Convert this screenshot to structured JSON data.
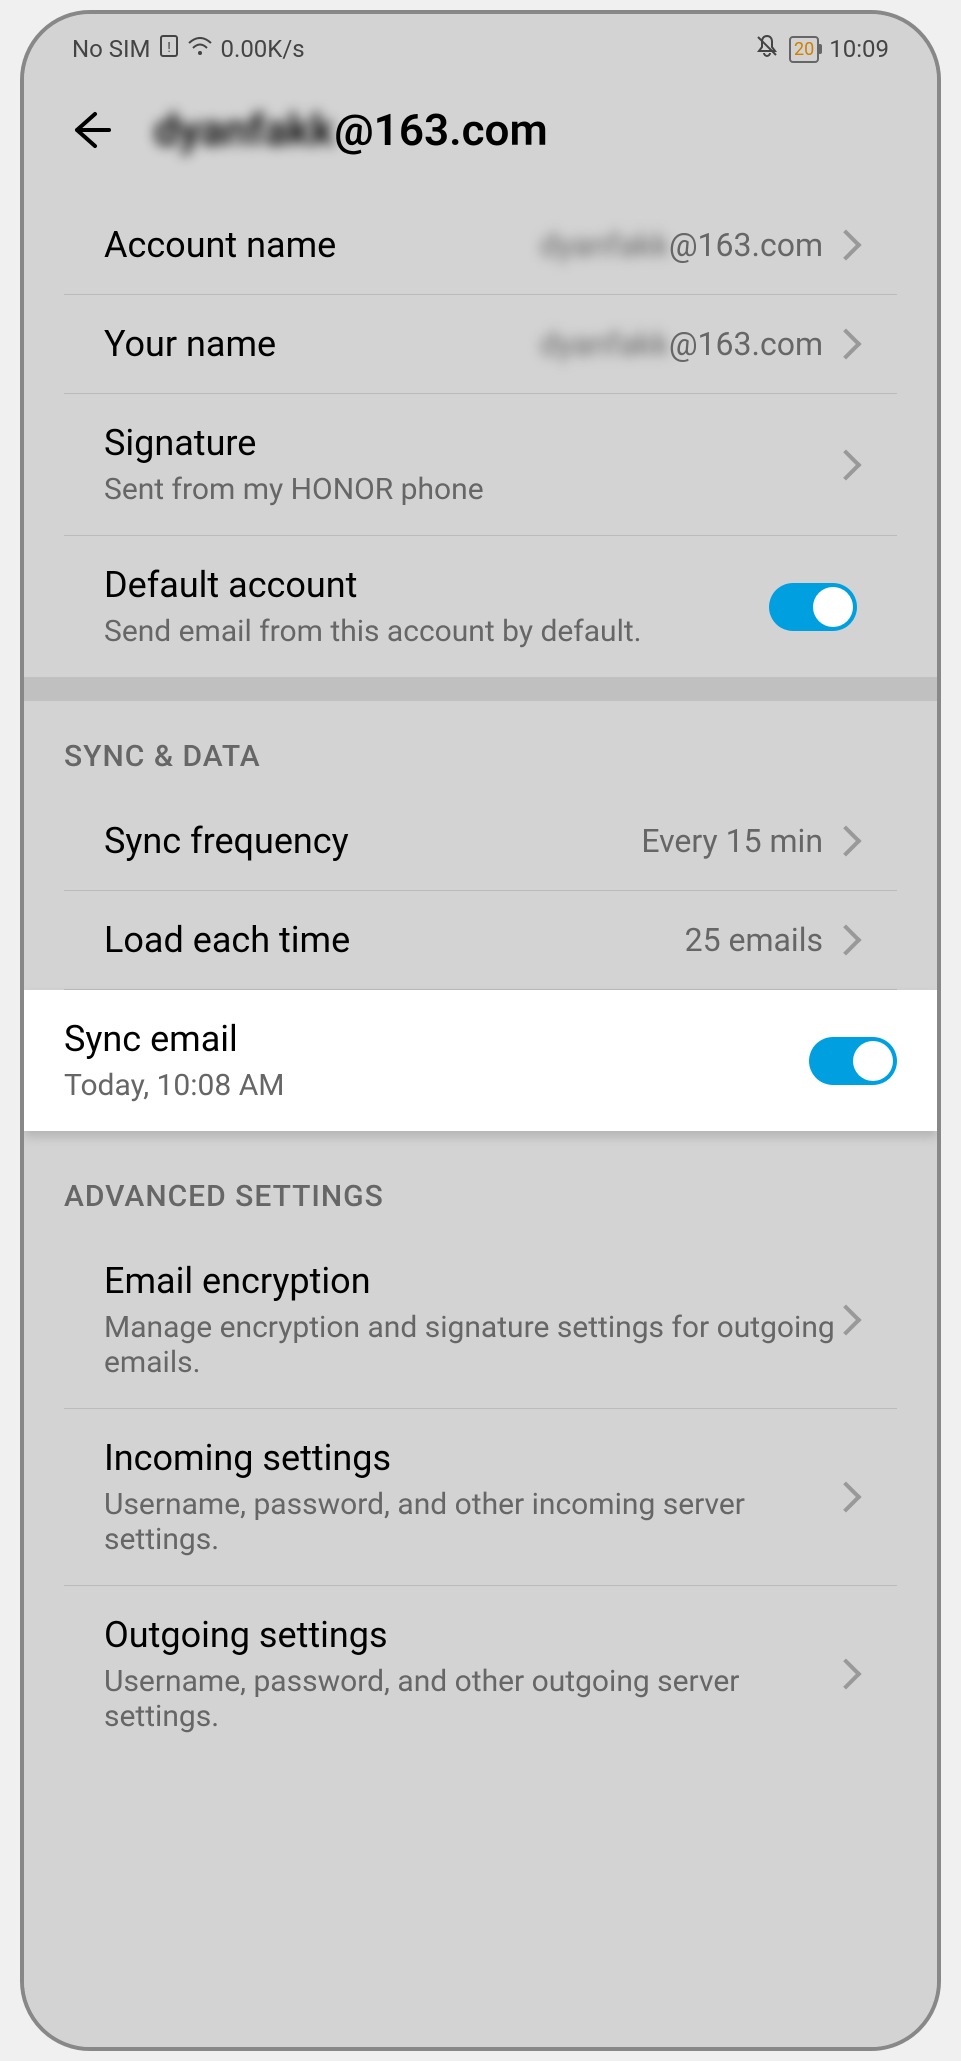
{
  "status": {
    "sim": "No SIM",
    "speed": "0.00K/s",
    "battery": "20",
    "time": "10:09"
  },
  "header": {
    "title_prefix": "dyanfakk",
    "title_suffix": "@163.com"
  },
  "account": {
    "name_label": "Account name",
    "name_value_prefix": "dyanfakk",
    "name_value_suffix": "@163.com",
    "your_name_label": "Your name",
    "your_name_value_prefix": "dyanfakk",
    "your_name_value_suffix": "@163.com",
    "signature_label": "Signature",
    "signature_value": "Sent from my HONOR phone",
    "default_label": "Default account",
    "default_sub": "Send email from this account by default."
  },
  "sync": {
    "header": "SYNC & DATA",
    "freq_label": "Sync frequency",
    "freq_value": "Every 15 min",
    "load_label": "Load each time",
    "load_value": "25 emails",
    "sync_email_label": "Sync email",
    "sync_email_sub": "Today, 10:08 AM"
  },
  "advanced": {
    "header": "ADVANCED SETTINGS",
    "encryption_label": "Email encryption",
    "encryption_sub": "Manage encryption and signature settings for outgoing emails.",
    "incoming_label": "Incoming settings",
    "incoming_sub": "Username, password, and other incoming server settings.",
    "outgoing_label": "Outgoing settings",
    "outgoing_sub": "Username, password, and other outgoing server settings."
  }
}
